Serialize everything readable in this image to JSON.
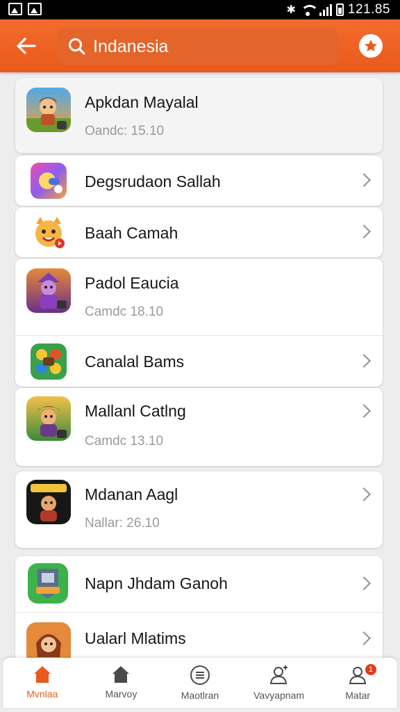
{
  "status_bar": {
    "time": "121.85"
  },
  "header": {
    "search_value": "Indanesia"
  },
  "colors": {
    "accent": "#ea5a1c",
    "header_search_bg": "#e5642a",
    "badge": "#e23b1b"
  },
  "apps": [
    {
      "title": "Apkdan Mayalal",
      "subtitle": "Oandc: 15.10",
      "icon": "game-icon-adventurer",
      "chevron": false
    },
    {
      "title": "Degsrudaon Sallah",
      "subtitle": "",
      "icon": "app-icon-gradient-face",
      "chevron": true
    },
    {
      "title": "Baah Camah",
      "subtitle": "",
      "icon": "app-icon-cartoon-cat",
      "chevron": true
    },
    {
      "title": "Padol Eaucia",
      "subtitle": "Camdc 18.10",
      "icon": "game-icon-purple-hero",
      "chevron": false
    },
    {
      "title": "Canalal Bams",
      "subtitle": "",
      "icon": "game-icon-puzzle",
      "chevron": true
    },
    {
      "title": "Mallanl Catlng",
      "subtitle": "Camdc 13.10",
      "icon": "game-icon-warrior",
      "chevron": true
    },
    {
      "title": "Mdanan Aagl",
      "subtitle": "Nallar: 26.10",
      "icon": "game-icon-dark-hero",
      "chevron": true
    },
    {
      "title": "Napn Jhdam Ganoh",
      "subtitle": "",
      "icon": "game-icon-shield",
      "chevron": true
    },
    {
      "title": "Ualarl Mlatims",
      "subtitle": "",
      "icon": "game-icon-girl",
      "chevron": true
    }
  ],
  "bottom_nav": [
    {
      "label": "Mvnlaa",
      "icon": "home-filled-icon",
      "active": true
    },
    {
      "label": "Marvoy",
      "icon": "home-icon",
      "active": false
    },
    {
      "label": "Maotlran",
      "icon": "menu-circle-icon",
      "active": false
    },
    {
      "label": "Vavyapnam",
      "icon": "user-add-icon",
      "active": false
    },
    {
      "label": "Matar",
      "icon": "user-icon",
      "active": false,
      "badge": "1"
    }
  ]
}
